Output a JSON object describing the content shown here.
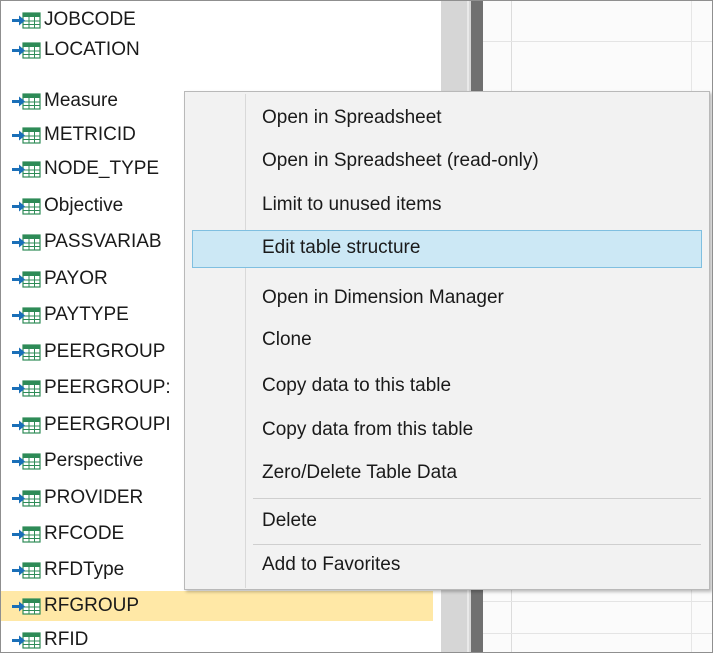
{
  "tree": {
    "items": [
      {
        "label": "JOBCODE"
      },
      {
        "label": "LOCATION"
      },
      {
        "label": "Measure"
      },
      {
        "label": "METRICID"
      },
      {
        "label": "NODE_TYPE"
      },
      {
        "label": "Objective"
      },
      {
        "label": "PASSVARIAB"
      },
      {
        "label": "PAYOR"
      },
      {
        "label": "PAYTYPE"
      },
      {
        "label": "PEERGROUP"
      },
      {
        "label": "PEERGROUP:"
      },
      {
        "label": "PEERGROUPI"
      },
      {
        "label": "Perspective"
      },
      {
        "label": "PROVIDER"
      },
      {
        "label": "RFCODE"
      },
      {
        "label": "RFDType"
      },
      {
        "label": "RFGROUP"
      },
      {
        "label": "RFID"
      }
    ],
    "selected_label": "RFGROUP",
    "icon": "table-arrow-icon"
  },
  "context_menu": {
    "items": [
      {
        "label": "Open in Spreadsheet"
      },
      {
        "label": "Open in Spreadsheet (read-only)"
      },
      {
        "label": "Limit to unused items"
      },
      {
        "label": "Edit table structure"
      },
      {
        "label": "Open in Dimension Manager"
      },
      {
        "label": "Clone"
      },
      {
        "label": "Copy data to this table"
      },
      {
        "label": "Copy data from this table"
      },
      {
        "label": "Zero/Delete Table Data"
      },
      {
        "label": "Delete"
      },
      {
        "label": "Add to Favorites"
      }
    ],
    "highlighted_label": "Edit table structure"
  },
  "colors": {
    "selection": "#ffe8a6",
    "menu_hover": "#cce8f5",
    "menu_hover_border": "#7fbfe0",
    "icon_arrow": "#1a6fb8",
    "icon_table": "#2e8b57"
  }
}
